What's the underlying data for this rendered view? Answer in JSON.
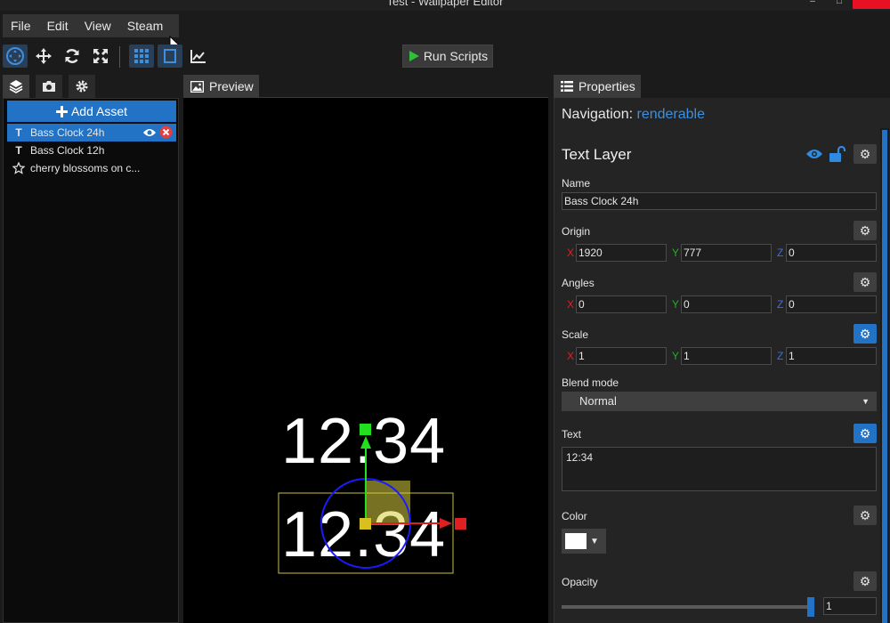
{
  "window": {
    "title": "Test - Wallpaper Editor",
    "minimize": "–",
    "maximize": "□",
    "close": ""
  },
  "menu": {
    "items": [
      "File",
      "Edit",
      "View",
      "Steam"
    ]
  },
  "toolbar": {
    "run_scripts": "Run Scripts"
  },
  "left": {
    "add_asset": "Add Asset",
    "assets": [
      {
        "label": "Bass Clock 24h",
        "icon": "text-icon",
        "selected": true
      },
      {
        "label": "Bass Clock 12h",
        "icon": "text-icon",
        "selected": false
      },
      {
        "label": "cherry blossoms on c...",
        "icon": "star-icon",
        "selected": false
      }
    ]
  },
  "preview": {
    "tab": "Preview",
    "clock_top": "12:34",
    "clock_bottom": "12:34"
  },
  "properties": {
    "tab": "Properties",
    "nav_label": "Navigation:",
    "nav_link": "renderable",
    "layer_title": "Text Layer",
    "name_label": "Name",
    "name_value": "Bass Clock 24h",
    "origin_label": "Origin",
    "origin": {
      "x": "1920",
      "y": "777",
      "z": "0"
    },
    "angles_label": "Angles",
    "angles": {
      "x": "0",
      "y": "0",
      "z": "0"
    },
    "scale_label": "Scale",
    "scale": {
      "x": "1",
      "y": "1",
      "z": "1"
    },
    "axis": {
      "x": "X",
      "y": "Y",
      "z": "Z"
    },
    "blend_label": "Blend mode",
    "blend_value": "Normal",
    "text_label": "Text",
    "text_value": "12:34",
    "color_label": "Color",
    "color_value": "#ffffff",
    "opacity_label": "Opacity",
    "opacity_value": "1"
  },
  "colors": {
    "accent": "#2273c6",
    "axis_x": "#e02020",
    "axis_y": "#1fb31f",
    "axis_z": "#3d6fe0"
  }
}
